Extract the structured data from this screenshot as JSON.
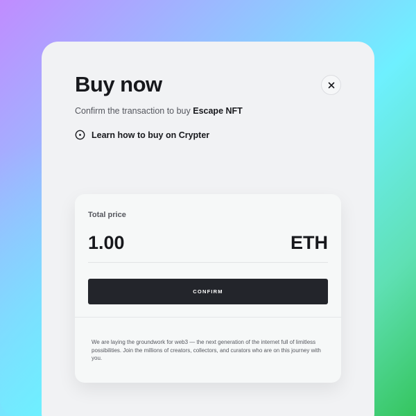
{
  "modal": {
    "title": "Buy now",
    "subtitle_prefix": "Confirm the transaction to buy ",
    "subtitle_item": "Escape NFT",
    "learn_link": "Learn how to buy on Crypter"
  },
  "price_card": {
    "label": "Total price",
    "amount": "1.00",
    "currency": "ETH",
    "confirm_label": "CONFIRM",
    "footer_text": "We are laying the groundwork for web3 — the next generation of the internet full of limitless possibilities. Join the millions of creators, collectors, and curators who are on this journey with you."
  },
  "icons": {
    "close": "close-icon",
    "learn": "play-circle-icon"
  },
  "colors": {
    "button_bg": "#23252b",
    "modal_bg": "#f1f2f4",
    "card_bg": "#f6f8f8",
    "text_primary": "#17181c",
    "text_secondary": "#55575e"
  }
}
